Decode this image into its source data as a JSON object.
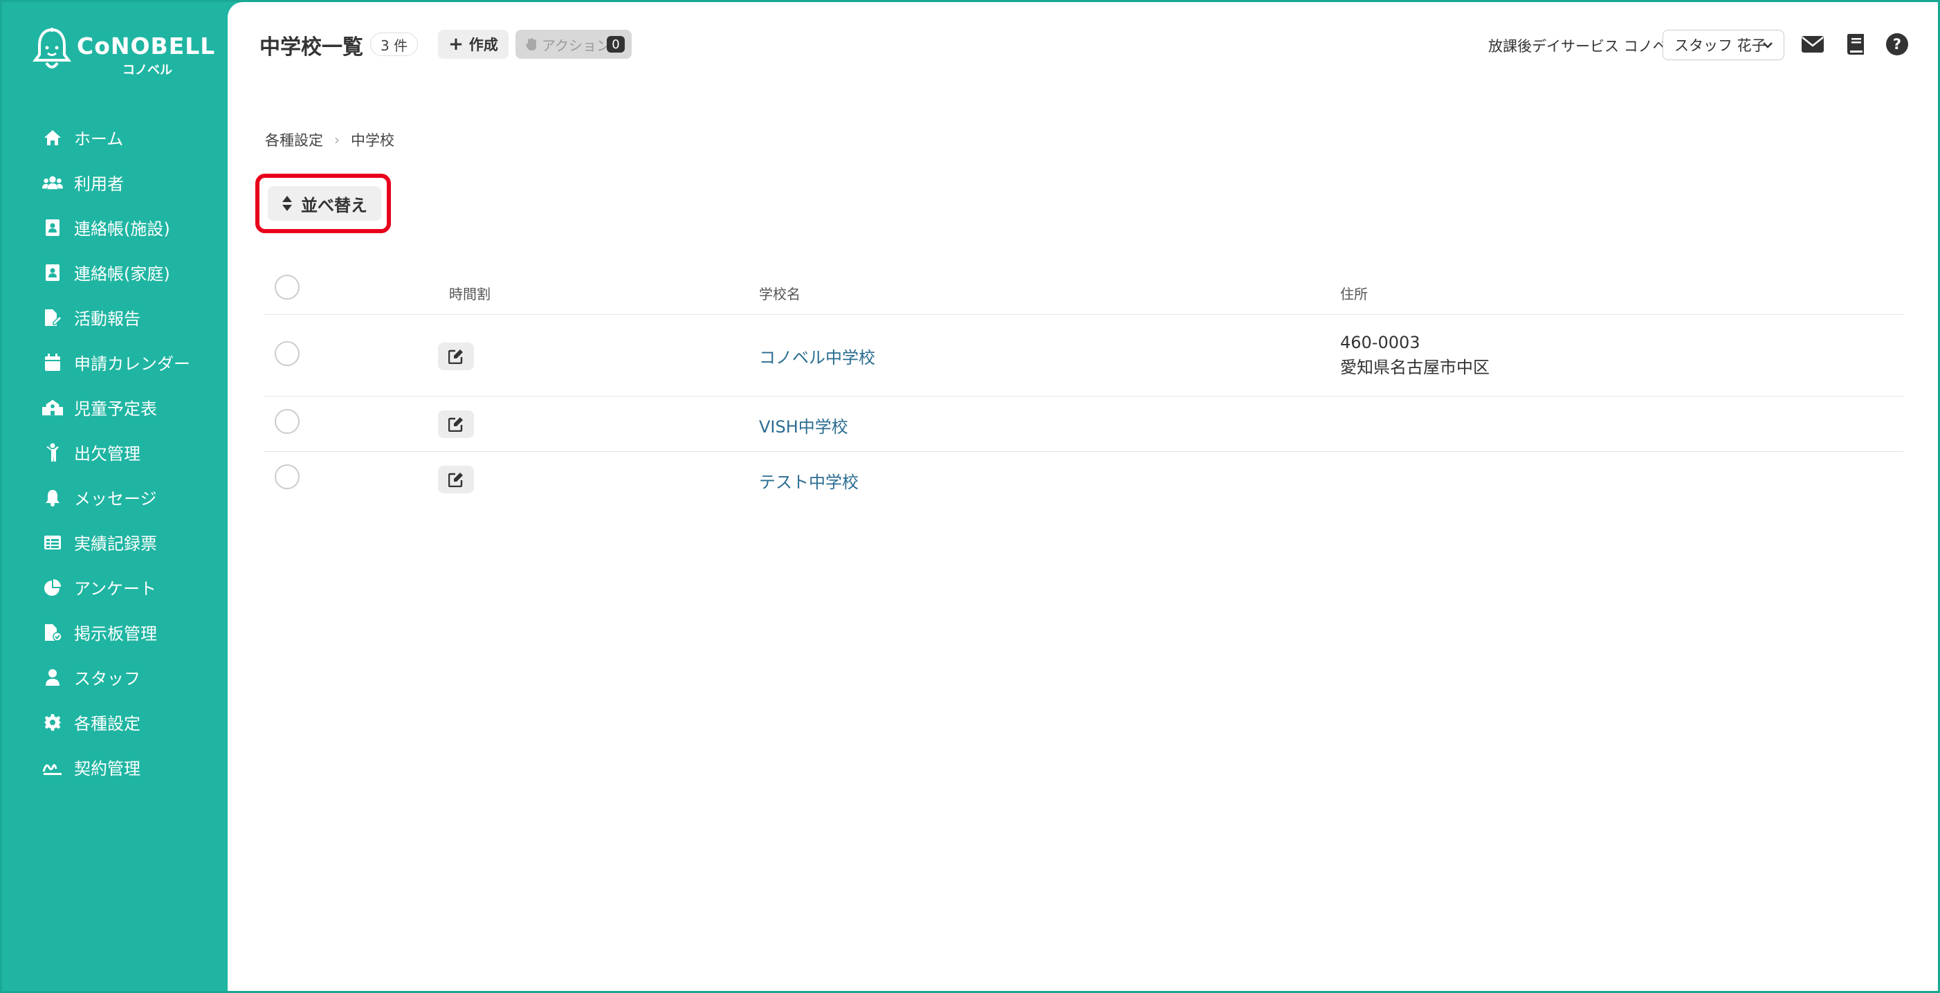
{
  "app": {
    "brand": "CoNOBELL",
    "brand_sub": "コノベル"
  },
  "sidebar": {
    "items": [
      {
        "label": "ホーム",
        "icon": "home-icon"
      },
      {
        "label": "利用者",
        "icon": "users-icon"
      },
      {
        "label": "連絡帳(施設)",
        "icon": "contact-book-icon"
      },
      {
        "label": "連絡帳(家庭)",
        "icon": "contact-book-icon"
      },
      {
        "label": "活動報告",
        "icon": "file-edit-icon"
      },
      {
        "label": "申請カレンダー",
        "icon": "calendar-icon"
      },
      {
        "label": "児童予定表",
        "icon": "school-icon"
      },
      {
        "label": "出欠管理",
        "icon": "child-icon"
      },
      {
        "label": "メッセージ",
        "icon": "bell-icon"
      },
      {
        "label": "実績記録票",
        "icon": "table-icon"
      },
      {
        "label": "アンケート",
        "icon": "pie-chart-icon"
      },
      {
        "label": "掲示板管理",
        "icon": "file-check-icon"
      },
      {
        "label": "スタッフ",
        "icon": "staff-icon"
      },
      {
        "label": "各種設定",
        "icon": "gear-icon"
      },
      {
        "label": "契約管理",
        "icon": "contract-icon"
      }
    ]
  },
  "header": {
    "title": "中学校一覧",
    "count": "3 件",
    "create_label": "作成",
    "action_label": "アクション",
    "action_count": "0",
    "facility": "放課後デイサービス コノベル",
    "staff_name": "スタッフ 花子"
  },
  "breadcrumb": {
    "items": [
      "各種設定",
      "中学校"
    ]
  },
  "toolbar": {
    "sort_label": "並べ替え"
  },
  "table": {
    "headers": {
      "timetable": "時間割",
      "school_name": "学校名",
      "address": "住所"
    },
    "rows": [
      {
        "name": "コノベル中学校",
        "postal": "460-0003",
        "address": "愛知県名古屋市中区"
      },
      {
        "name": "VISH中学校",
        "postal": "",
        "address": ""
      },
      {
        "name": "テスト中学校",
        "postal": "",
        "address": ""
      }
    ]
  },
  "colors": {
    "sidebar": "#1fb5a2",
    "link": "#2a6c91",
    "highlight": "#e8001c"
  }
}
